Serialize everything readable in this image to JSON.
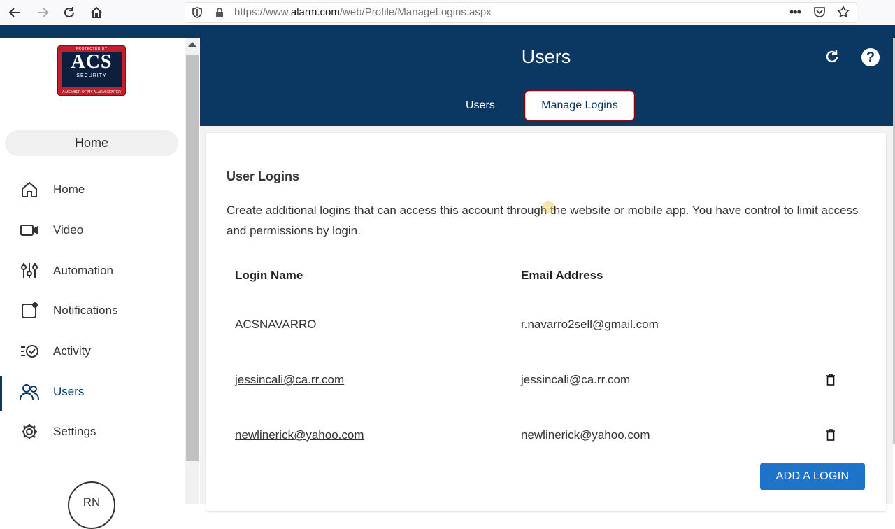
{
  "browser": {
    "url_scheme": "https://www.",
    "url_host": "alarm.com",
    "url_path": "/web/Profile/ManageLogins.aspx"
  },
  "sidebar": {
    "logo_text": "ACS",
    "logo_sub": "SECURITY",
    "logo_top": "PROTECTED BY",
    "logo_bottom": "A MEMBER OF MY ALARM CENTER",
    "home_pill": "Home",
    "items": [
      {
        "label": "Home",
        "icon": "home-icon"
      },
      {
        "label": "Video",
        "icon": "video-icon"
      },
      {
        "label": "Automation",
        "icon": "sliders-icon"
      },
      {
        "label": "Notifications",
        "icon": "notification-icon"
      },
      {
        "label": "Activity",
        "icon": "activity-icon"
      },
      {
        "label": "Users",
        "icon": "users-icon",
        "active": true
      },
      {
        "label": "Settings",
        "icon": "gear-icon"
      }
    ],
    "avatar_initials": "RN"
  },
  "header": {
    "title": "Users",
    "tabs": [
      {
        "label": "Users"
      },
      {
        "label": "Manage Logins",
        "selected": true
      }
    ],
    "help_label": "?"
  },
  "card": {
    "title": "User Logins",
    "description": "Create additional logins that can access this account through the website or mobile app. You have control to limit access and permissions by login.",
    "columns": [
      "Login Name",
      "Email Address"
    ],
    "rows": [
      {
        "login": "ACSNAVARRO",
        "email": "r.navarro2sell@gmail.com",
        "deletable": false
      },
      {
        "login": "jessincali@ca.rr.com",
        "email": "jessincali@ca.rr.com",
        "deletable": true
      },
      {
        "login": "newlinerick@yahoo.com",
        "email": "newlinerick@yahoo.com",
        "deletable": true
      }
    ],
    "add_button": "ADD A LOGIN"
  },
  "colors": {
    "brand_navy": "#0b3862",
    "button_blue": "#1e74c9",
    "logo_red": "#c0202c"
  }
}
